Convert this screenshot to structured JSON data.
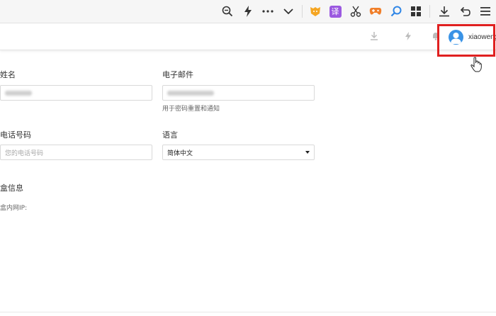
{
  "browser_toolbar": {
    "items": [
      {
        "icon": "zoom-out-icon"
      },
      {
        "icon": "lightning-icon"
      },
      {
        "icon": "more-icon"
      },
      {
        "icon": "chevron-down-icon"
      },
      {
        "icon": "bear-extension-icon",
        "color": "#f5a623"
      },
      {
        "icon": "translate-extension-icon",
        "label": "译",
        "color": "#9b59e0"
      },
      {
        "icon": "scissors-icon"
      },
      {
        "icon": "game-extension-icon",
        "color": "#f07f2a"
      },
      {
        "icon": "search-extension-icon",
        "color": "#2f86e6"
      },
      {
        "icon": "grid-icon"
      },
      {
        "icon": "download-icon"
      },
      {
        "icon": "undo-icon"
      },
      {
        "icon": "menu-icon"
      }
    ]
  },
  "app_header": {
    "icons": [
      "download-icon",
      "lightning-icon",
      "bell-icon"
    ],
    "user": {
      "name": "xiaoweng",
      "avatar_color": "#3a93e6"
    },
    "highlight_color": "#e02020"
  },
  "form": {
    "name_label": "姓名",
    "email_label": "电子邮件",
    "email_hint": "用于密码重置和通知",
    "phone_label": "电话号码",
    "phone_placeholder": "您的电话号码",
    "language_label": "语言",
    "language_value": "简体中文"
  },
  "section": {
    "title": "盒信息",
    "ip_label": "盒内网IP:"
  }
}
